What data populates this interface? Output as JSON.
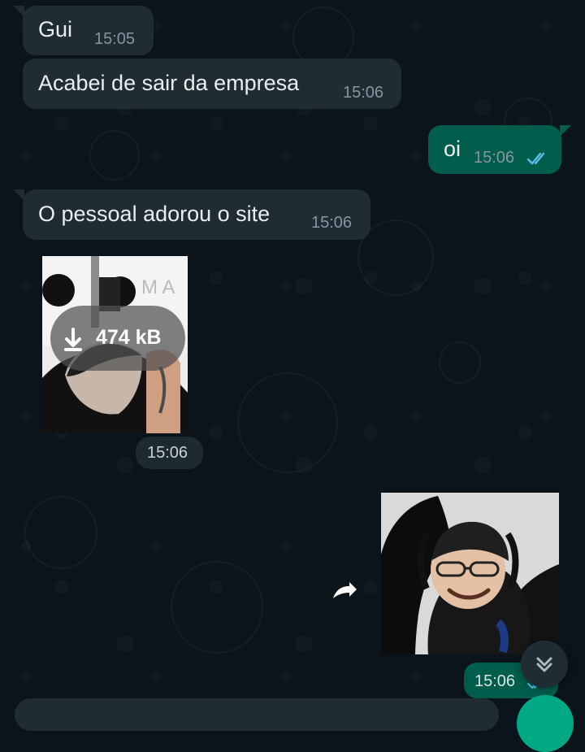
{
  "chat": {
    "messages": [
      {
        "direction": "incoming",
        "text": "Gui",
        "time": "15:05"
      },
      {
        "direction": "incoming",
        "text": "Acabei de sair da empresa",
        "time": "15:06"
      },
      {
        "direction": "outgoing",
        "text": "oi",
        "time": "15:06",
        "status": "read"
      },
      {
        "direction": "incoming",
        "text": "O pessoal adorou o site",
        "time": "15:06"
      },
      {
        "direction": "incoming",
        "type": "image",
        "size": "474 kB",
        "time": "15:06"
      },
      {
        "direction": "outgoing",
        "type": "image",
        "time": "15:06",
        "status": "read"
      }
    ]
  },
  "colors": {
    "background": "#0b141a",
    "incoming_bubble": "#202c33",
    "outgoing_bubble": "#005c4b",
    "accent": "#00a884",
    "read_check": "#53bdeb"
  },
  "icons": {
    "download": "download-icon",
    "forward": "forward-icon",
    "scroll_down": "chevron-double-down-icon",
    "read_receipt": "double-check-icon"
  }
}
